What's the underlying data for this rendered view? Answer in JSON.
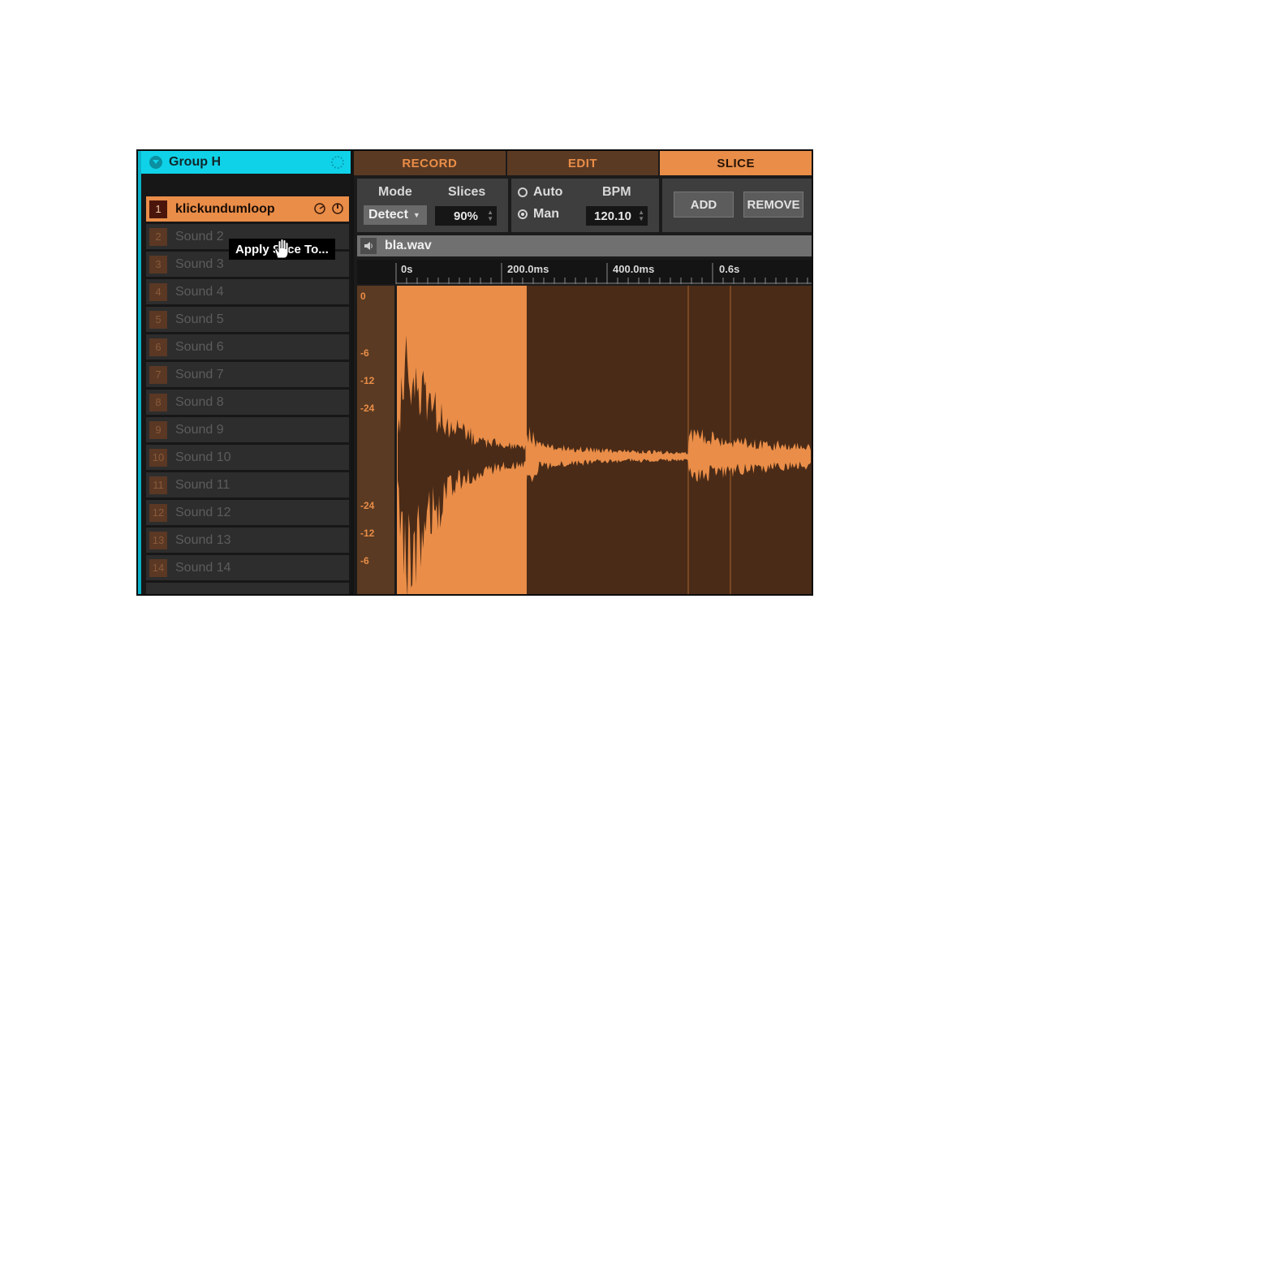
{
  "group": {
    "name": "Group H"
  },
  "sounds": [
    {
      "num": "1",
      "label": "klickundumloop",
      "active": true
    },
    {
      "num": "2",
      "label": "Sound 2"
    },
    {
      "num": "3",
      "label": "Sound 3"
    },
    {
      "num": "4",
      "label": "Sound 4"
    },
    {
      "num": "5",
      "label": "Sound 5"
    },
    {
      "num": "6",
      "label": "Sound 6"
    },
    {
      "num": "7",
      "label": "Sound 7"
    },
    {
      "num": "8",
      "label": "Sound 8"
    },
    {
      "num": "9",
      "label": "Sound 9"
    },
    {
      "num": "10",
      "label": "Sound 10"
    },
    {
      "num": "11",
      "label": "Sound 11"
    },
    {
      "num": "12",
      "label": "Sound 12"
    },
    {
      "num": "13",
      "label": "Sound 13"
    },
    {
      "num": "14",
      "label": "Sound 14"
    }
  ],
  "tooltip": {
    "text": "Apply Slice To..."
  },
  "tabs": [
    {
      "label": "RECORD",
      "active": false
    },
    {
      "label": "EDIT",
      "active": false
    },
    {
      "label": "SLICE",
      "active": true
    }
  ],
  "controls": {
    "mode_label": "Mode",
    "mode_value": "Detect",
    "slices_label": "Slices",
    "slices_value": "90%",
    "auto_label": "Auto",
    "man_label": "Man",
    "selected_radio": "Man",
    "bpm_label": "BPM",
    "bpm_value": "120.10",
    "add_label": "ADD",
    "remove_label": "REMOVE"
  },
  "file": {
    "name": "bla.wav"
  },
  "ruler": {
    "labels": [
      "0s",
      "200.0ms",
      "400.0ms",
      "0.6s"
    ]
  },
  "db_scale": [
    "0",
    "-6",
    "-12",
    "-24",
    "-24",
    "-12",
    "-6"
  ],
  "colors": {
    "accent": "#e98d48",
    "group": "#0fd2e8",
    "waveform_bg": "#4a2b17"
  },
  "icons": {
    "group_collapse": "chevron-down-icon",
    "speaker": "speaker-icon",
    "row_tools": [
      "tune-icon",
      "power-icon"
    ],
    "cursor": "hand-cursor-icon"
  }
}
